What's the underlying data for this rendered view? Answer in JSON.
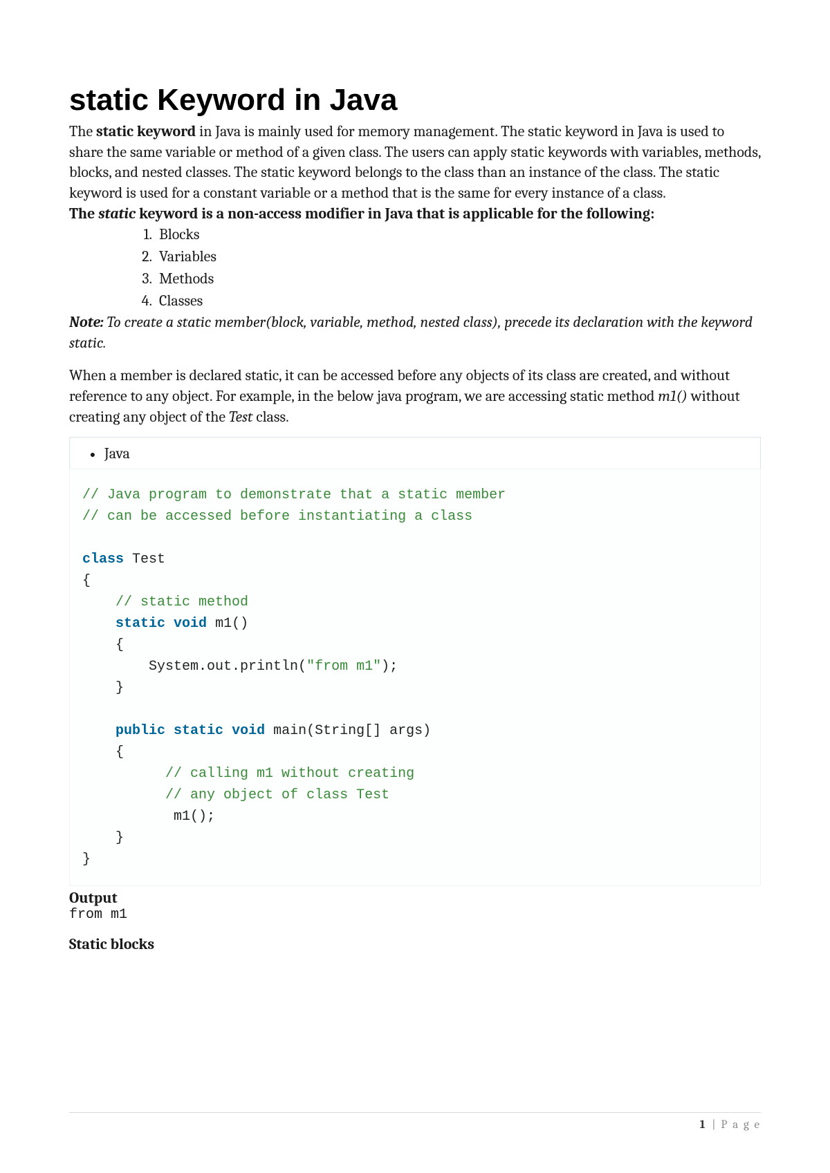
{
  "title": "static Keyword in Java",
  "intro": {
    "lead_bold": "static keyword",
    "lead_before": "The ",
    "lead_after": " in Java is mainly used for memory management. The static keyword in Java is used to share the same variable or method of a given class. The users can apply static keywords with variables, methods, blocks, and nested classes. The static keyword belongs to the class than an instance of the class. The static keyword is used for a constant variable or a method that is the same for every instance of a class."
  },
  "applicable": {
    "pre": "The ",
    "kw": "static",
    "post": " keyword is a non-access modifier in Java that is applicable for the following:",
    "items": [
      "Blocks",
      "Variables",
      "Methods",
      "Classes"
    ]
  },
  "note": {
    "label": "Note:",
    "text": " To create a static member(block, variable, method, nested class), precede its declaration with the keyword static."
  },
  "para2": {
    "t1": "When a member is declared static, it can be accessed before any objects of its class are created, and without reference to any object. For example, in the below java program, we are accessing static method ",
    "m": "m1()",
    "t2": " without creating any object of the ",
    "cls": "Test",
    "t3": " class."
  },
  "tab_label": "Java",
  "code": {
    "c1": "// Java program to demonstrate that a static member",
    "c2": "// can be accessed before instantiating a class",
    "kw_class": "class",
    "name_test": "Test",
    "brace_o": "{",
    "c3": "// static method",
    "kw_static": "static",
    "kw_void": "void",
    "m1_sig": "m1()",
    "sys_print": "System.out.println(",
    "str_from_m1": "\"from m1\"",
    "paren_semi": ");",
    "brace_c": "}",
    "kw_public": "public",
    "main_sig": "main(String[] args)",
    "c4": "// calling m1 without creating",
    "c5": "// any object of class Test",
    "m1_call": "m1();"
  },
  "output": {
    "label": "Output",
    "value": "from m1"
  },
  "subheading": "Static blocks",
  "footer": {
    "page_num": "1",
    "page_word": "P a g e"
  }
}
